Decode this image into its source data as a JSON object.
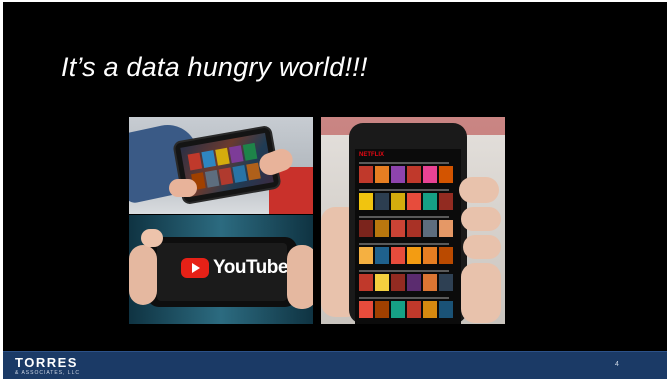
{
  "slide": {
    "title": "It’s a data hungry world!!!",
    "page_number": "4"
  },
  "images": {
    "tablet": {
      "icon": "tablet-streaming-photo"
    },
    "youtube": {
      "icon": "youtube-phone-photo",
      "wordmark": "YouTube"
    },
    "netflix": {
      "icon": "netflix-phone-photo",
      "brand": "NETFLIX"
    }
  },
  "footer": {
    "logo_main": "TORRES",
    "logo_sub": "& ASSOCIATES, LLC"
  },
  "colors": {
    "slide_background": "#000000",
    "footer_background": "#1b3a66",
    "youtube_red": "#e62117",
    "netflix_red": "#e50914"
  }
}
